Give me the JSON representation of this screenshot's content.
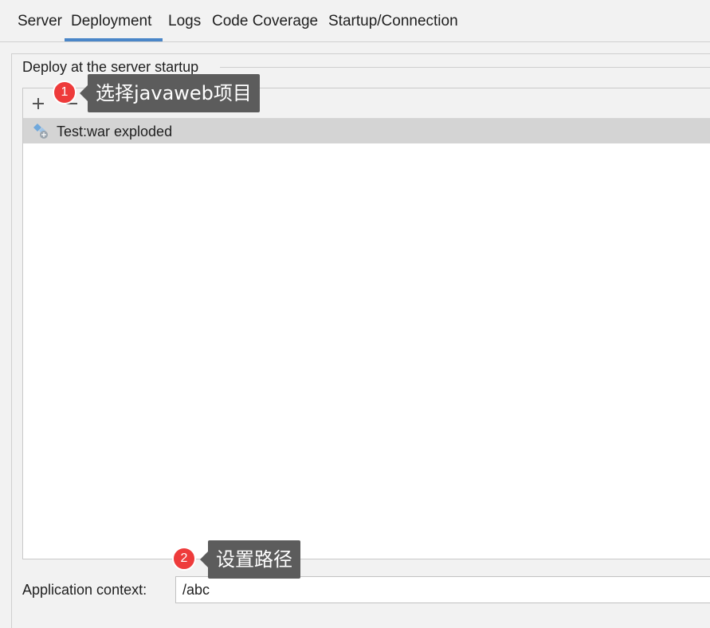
{
  "tabs": [
    {
      "label": "Server"
    },
    {
      "label": "Deployment"
    },
    {
      "label": "Logs"
    },
    {
      "label": "Code Coverage"
    },
    {
      "label": "Startup/Connection"
    }
  ],
  "active_tab": "Deployment",
  "deploy_group": {
    "title": "Deploy at the server startup",
    "toolbar": {
      "add_icon": "plus-icon",
      "remove_icon": "minus-icon",
      "move_icon": "arrow-up-icon",
      "edit_icon": "pencil-icon"
    },
    "items": [
      {
        "label": "Test:war exploded",
        "icon": "artifact-war-icon",
        "selected": true
      }
    ]
  },
  "application_context": {
    "label": "Application context:",
    "value": "/abc"
  },
  "annotations": [
    {
      "number": "1",
      "text": "选择javaweb项目"
    },
    {
      "number": "2",
      "text": "设置路径"
    }
  ],
  "colors": {
    "accent": "#4a86c8",
    "badge": "#ee3b3b",
    "callout": "#5c5c5c",
    "selected_row": "#d4d4d4"
  }
}
